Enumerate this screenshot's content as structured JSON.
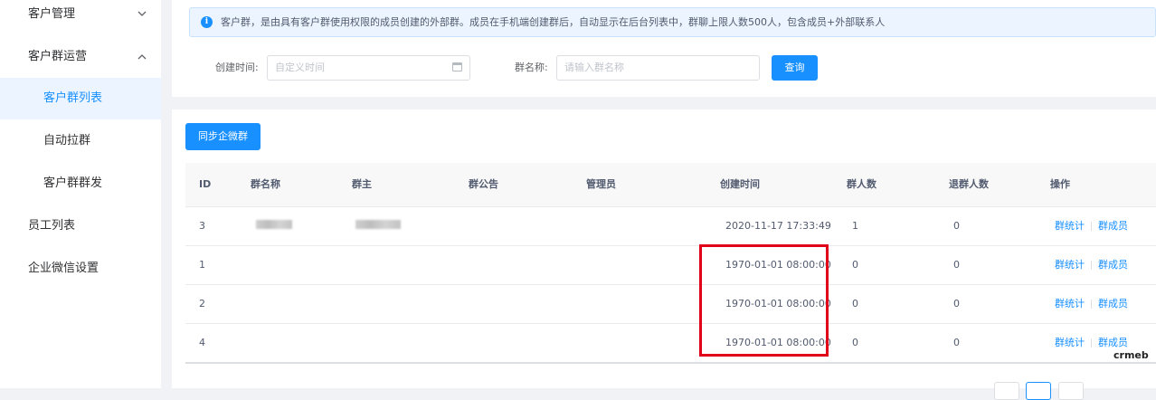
{
  "sidebar": {
    "items": [
      {
        "label": "客户管理",
        "chevron": "chevron-down-icon"
      },
      {
        "label": "客户群运营",
        "chevron": "chevron-up-icon"
      },
      {
        "label": "客户群列表",
        "active": true
      },
      {
        "label": "自动拉群"
      },
      {
        "label": "客户群群发"
      },
      {
        "label": "员工列表"
      },
      {
        "label": "企业微信设置"
      }
    ]
  },
  "alert": {
    "icon": "info-icon",
    "text": "客户群，是由具有客户群使用权限的成员创建的外部群。成员在手机端创建群后，自动显示在后台列表中，群聊上限人数500人，包含成员+外部联系人"
  },
  "filters": {
    "created_time_label": "创建时间:",
    "created_time_placeholder": "自定义时间",
    "group_name_label": "群名称:",
    "group_name_placeholder": "请输入群名称",
    "query_button": "查询"
  },
  "toolbar": {
    "sync_button": "同步企微群"
  },
  "table": {
    "headers": [
      "ID",
      "群名称",
      "群主",
      "群公告",
      "管理员",
      "创建时间",
      "群人数",
      "退群人数",
      "操作"
    ],
    "rows": [
      {
        "id": "3",
        "name": "",
        "owner": "",
        "notice": "",
        "admin": "",
        "created": "2020-11-17 17:33:49",
        "members": "1",
        "quit": "0",
        "blurred": true
      },
      {
        "id": "1",
        "name": "",
        "owner": "",
        "notice": "",
        "admin": "",
        "created": "1970-01-01 08:00:00",
        "members": "0",
        "quit": "0"
      },
      {
        "id": "2",
        "name": "",
        "owner": "",
        "notice": "",
        "admin": "",
        "created": "1970-01-01 08:00:00",
        "members": "0",
        "quit": "0"
      },
      {
        "id": "4",
        "name": "",
        "owner": "",
        "notice": "",
        "admin": "",
        "created": "1970-01-01 08:00:00",
        "members": "0",
        "quit": "0"
      }
    ],
    "actions": {
      "stats": "群统计",
      "members": "群成员"
    }
  },
  "watermark": "crmeb",
  "colors": {
    "primary": "#1890ff",
    "highlight": "#e1001a"
  }
}
